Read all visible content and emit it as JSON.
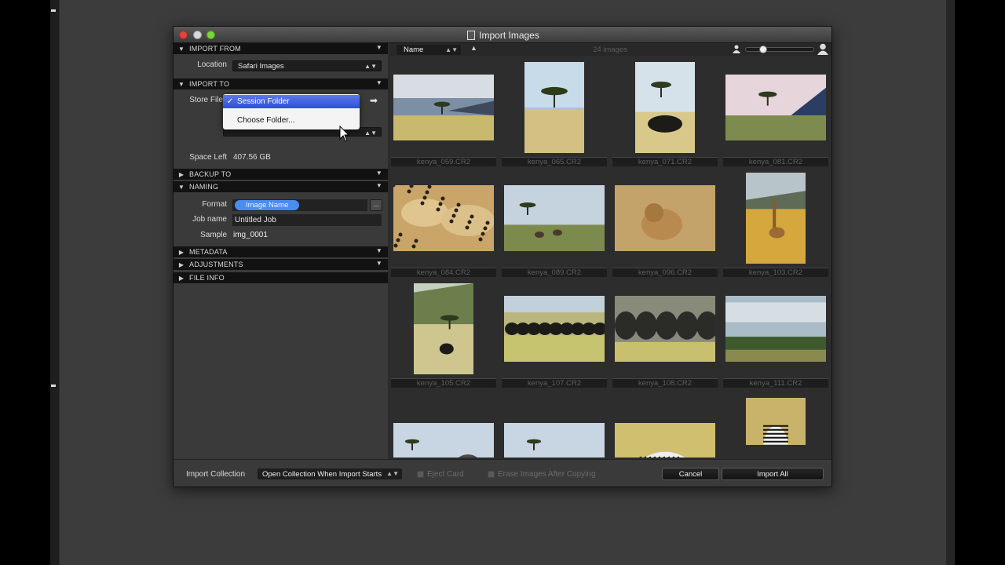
{
  "window": {
    "title": "Import Images"
  },
  "sidebar": {
    "import_from": {
      "header": "IMPORT FROM",
      "location_label": "Location",
      "location_value": "Safari Images"
    },
    "import_to": {
      "header": "IMPORT TO",
      "store_files_label": "Store Files",
      "space_left_label": "Space Left",
      "space_left_value": "407.56 GB",
      "dropdown": {
        "selected": "Session Folder",
        "check": "✓",
        "other": "Choose Folder..."
      }
    },
    "backup_to": {
      "header": "BACKUP TO"
    },
    "naming": {
      "header": "NAMING",
      "format_label": "Format",
      "format_token": "Image Name",
      "format_button": "...",
      "job_name_label": "Job name",
      "job_name_value": "Untitled Job",
      "sample_label": "Sample",
      "sample_value": "img_0001"
    },
    "metadata": {
      "header": "METADATA"
    },
    "adjustments": {
      "header": "ADJUSTMENTS"
    },
    "file_info": {
      "header": "FILE INFO"
    }
  },
  "grid": {
    "sort_label": "Name",
    "image_count": "24 images",
    "images": [
      {
        "name": "kenya_059.CR2",
        "subject": "storm-landscape"
      },
      {
        "name": "kenya_065.CR2",
        "subject": "acacia-tree"
      },
      {
        "name": "kenya_071.CR2",
        "subject": "buffalo-tree"
      },
      {
        "name": "kenya_081.CR2",
        "subject": "tree-horizon"
      },
      {
        "name": "kenya_084.CR2",
        "subject": "cheetahs"
      },
      {
        "name": "kenya_089.CR2",
        "subject": "antelope-tree"
      },
      {
        "name": "kenya_096.CR2",
        "subject": "lion"
      },
      {
        "name": "kenya_103.CR2",
        "subject": "giraffe"
      },
      {
        "name": "kenya_105.CR2",
        "subject": "buffalo-hill"
      },
      {
        "name": "kenya_107.CR2",
        "subject": "buffalo-herd"
      },
      {
        "name": "kenya_108.CR2",
        "subject": "buffalo-closeup"
      },
      {
        "name": "kenya_111.CR2",
        "subject": "plains"
      },
      {
        "name": "",
        "subject": "elephant"
      },
      {
        "name": "",
        "subject": "elephants"
      },
      {
        "name": "",
        "subject": "zebra"
      },
      {
        "name": "",
        "subject": "zebra-standing"
      }
    ]
  },
  "footer": {
    "import_collection_label": "Import Collection",
    "collection_option": "Open Collection When Import Starts",
    "eject_card_label": "Eject Card",
    "erase_label": "Erase Images After Copying",
    "cancel_label": "Cancel",
    "import_all_label": "Import All"
  },
  "colors": {
    "accent": "#4a8df0",
    "selection": "#2f50d8",
    "window_bg": "#2b2b2b",
    "panel_bg": "#3a3a3a"
  }
}
